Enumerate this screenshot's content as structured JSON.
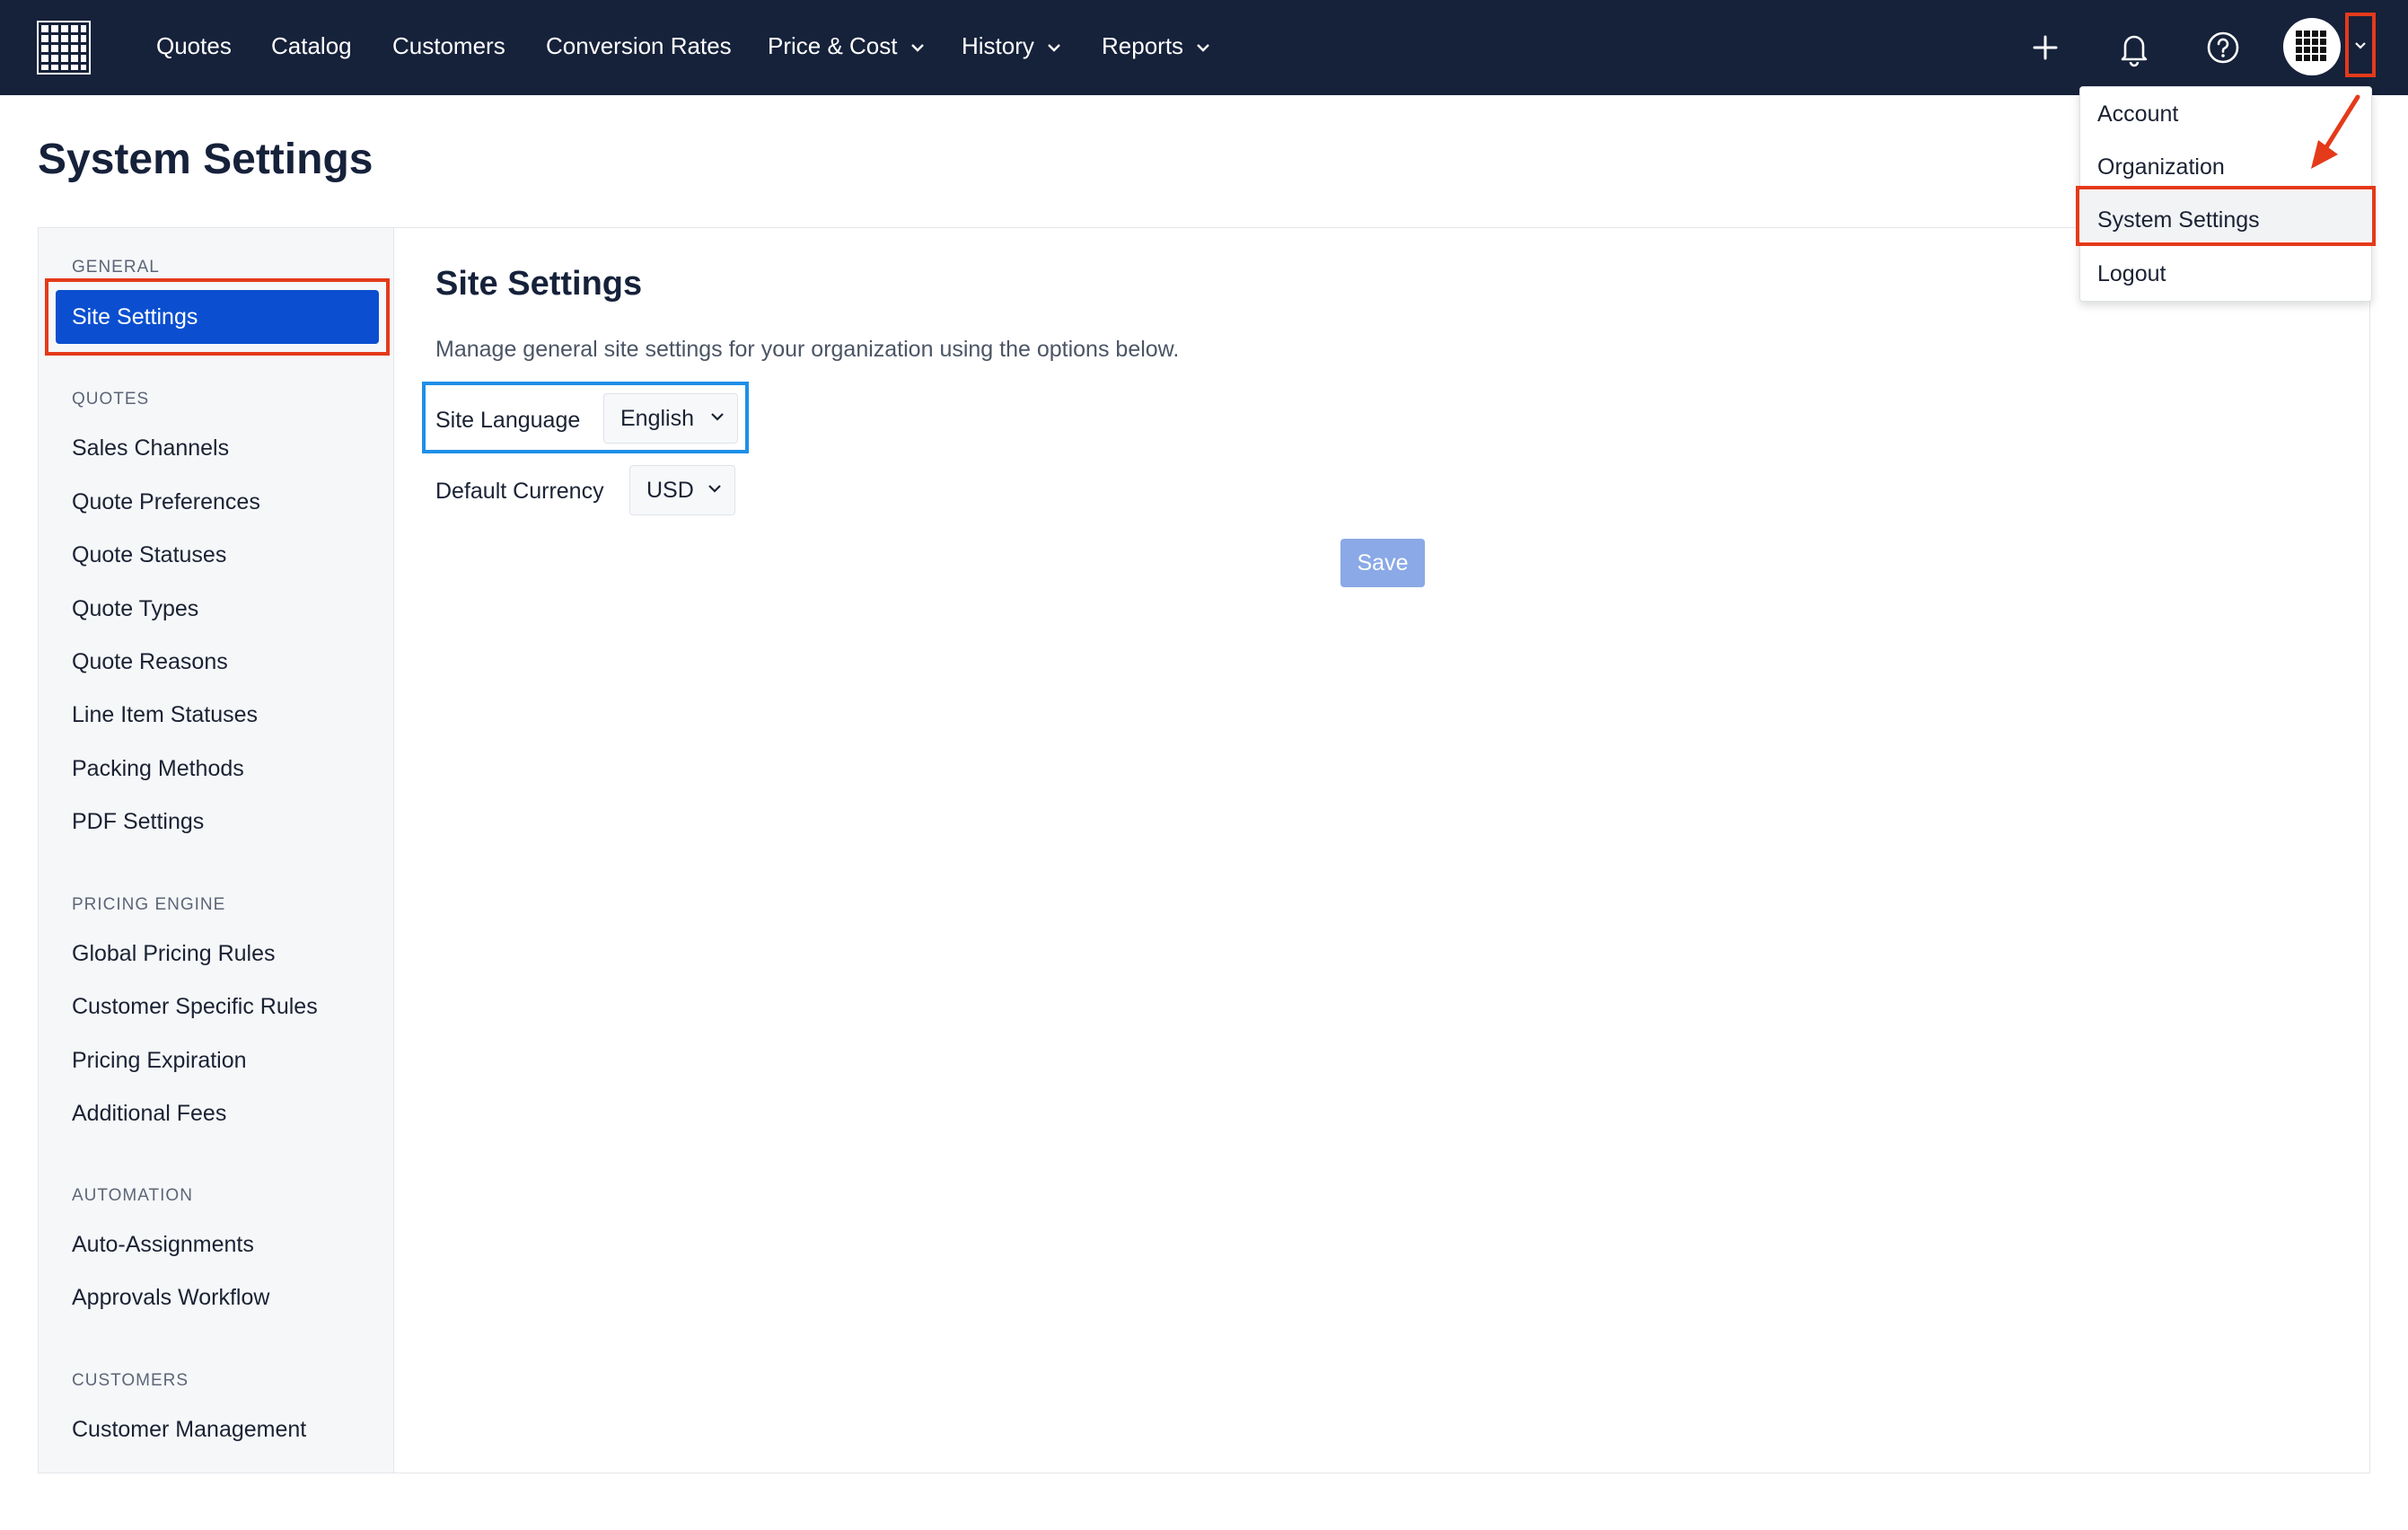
{
  "nav": {
    "items": [
      {
        "label": "Quotes",
        "has_menu": false
      },
      {
        "label": "Catalog",
        "has_menu": false
      },
      {
        "label": "Customers",
        "has_menu": false
      },
      {
        "label": "Conversion Rates",
        "has_menu": false
      },
      {
        "label": "Price & Cost",
        "has_menu": true
      },
      {
        "label": "History",
        "has_menu": true
      },
      {
        "label": "Reports",
        "has_menu": true
      }
    ],
    "icons": [
      "plus-icon",
      "bell-icon",
      "help-icon",
      "avatar",
      "chevron-down-icon"
    ]
  },
  "page": {
    "title": "System Settings"
  },
  "sidebar": {
    "general_label": "GENERAL",
    "site_settings": "Site Settings",
    "quotes_label": "QUOTES",
    "quotes_items": [
      "Sales Channels",
      "Quote Preferences",
      "Quote Statuses",
      "Quote Types",
      "Quote Reasons",
      "Line Item Statuses",
      "Packing Methods",
      "PDF Settings"
    ],
    "pricing_label": "PRICING ENGINE",
    "pricing_items": [
      "Global Pricing Rules",
      "Customer Specific Rules",
      "Pricing Expiration",
      "Additional Fees"
    ],
    "automation_label": "AUTOMATION",
    "automation_items": [
      "Auto-Assignments",
      "Approvals Workflow"
    ],
    "customers_label": "CUSTOMERS",
    "customers_items": [
      "Customer Management"
    ]
  },
  "main": {
    "title": "Site Settings",
    "description": "Manage general site settings for your organization using the options below.",
    "language_label": "Site Language",
    "language_value": "English",
    "currency_label": "Default Currency",
    "currency_value": "USD",
    "save_label": "Save"
  },
  "user_menu": {
    "items": [
      "Account",
      "Organization",
      "System Settings",
      "Logout"
    ],
    "highlighted": "System Settings"
  },
  "colors": {
    "nav_bg": "#16213a",
    "active_item": "#0b4fd0",
    "save_button": "#8aa9e6",
    "annotation_red": "#e43a1a",
    "annotation_blue": "#1e8fe8"
  }
}
